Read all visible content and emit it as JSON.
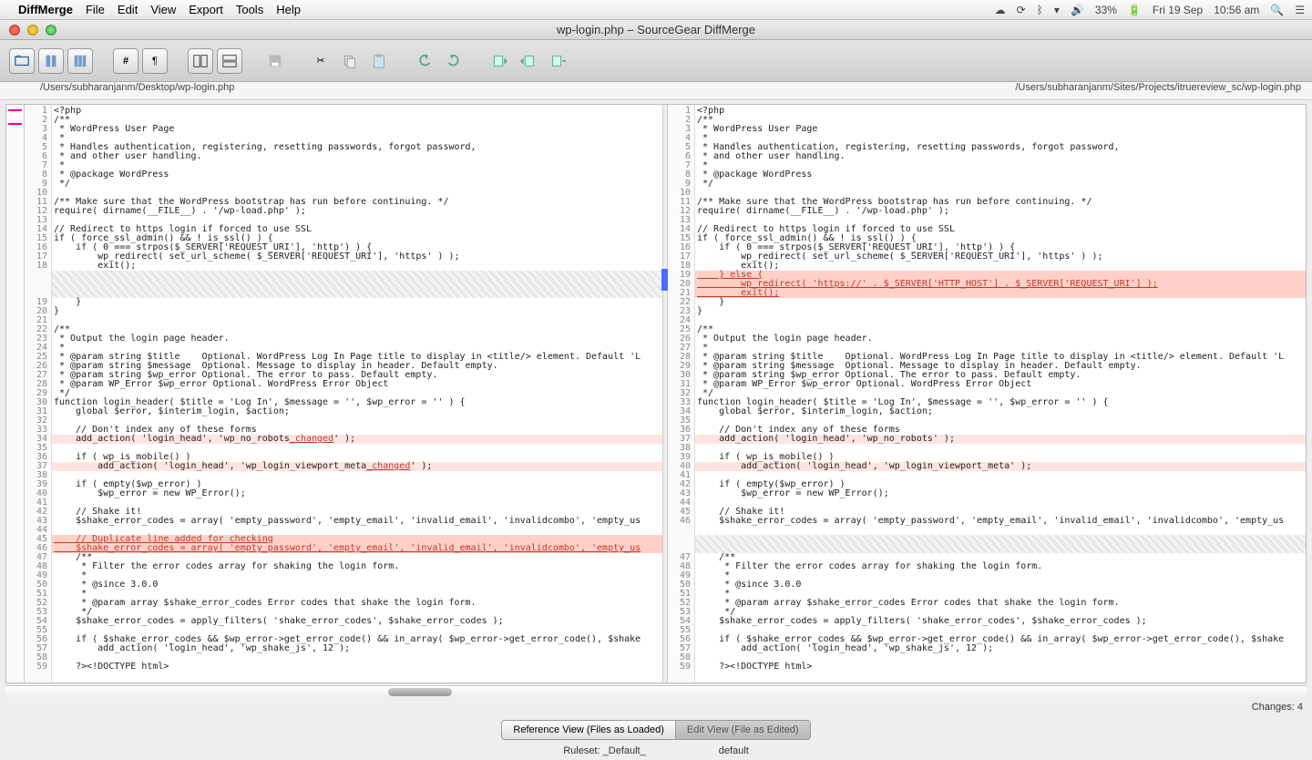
{
  "menubar": {
    "app": "DiffMerge",
    "items": [
      "File",
      "Edit",
      "View",
      "Export",
      "Tools",
      "Help"
    ],
    "right": {
      "battery": "33%",
      "date": "Fri 19 Sep",
      "time": "10:56 am"
    }
  },
  "window": {
    "title": "wp-login.php – SourceGear DiffMerge"
  },
  "paths": {
    "left": "/Users/subharanjanm/Desktop/wp-login.php",
    "right": "/Users/subharanjanm/Sites/Projects/itruereview_sc/wp-login.php"
  },
  "left_code": [
    {
      "n": "1",
      "t": "<?php"
    },
    {
      "n": "2",
      "t": "/**"
    },
    {
      "n": "3",
      "t": " * WordPress User Page"
    },
    {
      "n": "4",
      "t": " *"
    },
    {
      "n": "5",
      "t": " * Handles authentication, registering, resetting passwords, forgot password,"
    },
    {
      "n": "6",
      "t": " * and other user handling."
    },
    {
      "n": "7",
      "t": " *"
    },
    {
      "n": "8",
      "t": " * @package WordPress"
    },
    {
      "n": "9",
      "t": " */"
    },
    {
      "n": "10",
      "t": ""
    },
    {
      "n": "11",
      "t": "/** Make sure that the WordPress bootstrap has run before continuing. */"
    },
    {
      "n": "12",
      "t": "require( dirname(__FILE__) . '/wp-load.php' );"
    },
    {
      "n": "13",
      "t": ""
    },
    {
      "n": "14",
      "t": "// Redirect to https login if forced to use SSL"
    },
    {
      "n": "15",
      "t": "if ( force_ssl_admin() && ! is_ssl() ) {"
    },
    {
      "n": "16",
      "t": "    if ( 0 === strpos($_SERVER['REQUEST_URI'], 'http') ) {"
    },
    {
      "n": "17",
      "t": "        wp_redirect( set_url_scheme( $_SERVER['REQUEST_URI'], 'https' ) );"
    },
    {
      "n": "18",
      "t": "        exit();"
    },
    {
      "n": "",
      "t": "",
      "cls": "hatched"
    },
    {
      "n": "",
      "t": "",
      "cls": "hatched"
    },
    {
      "n": "",
      "t": "",
      "cls": "hatched"
    },
    {
      "n": "19",
      "t": "    }"
    },
    {
      "n": "20",
      "t": "}"
    },
    {
      "n": "21",
      "t": ""
    },
    {
      "n": "22",
      "t": "/**"
    },
    {
      "n": "23",
      "t": " * Output the login page header."
    },
    {
      "n": "24",
      "t": " *"
    },
    {
      "n": "25",
      "t": " * @param string $title    Optional. WordPress Log In Page title to display in <title/> element. Default 'L"
    },
    {
      "n": "26",
      "t": " * @param string $message  Optional. Message to display in header. Default empty."
    },
    {
      "n": "27",
      "t": " * @param string $wp_error Optional. The error to pass. Default empty."
    },
    {
      "n": "28",
      "t": " * @param WP_Error $wp_error Optional. WordPress Error Object"
    },
    {
      "n": "29",
      "t": " */"
    },
    {
      "n": "30",
      "t": "function login_header( $title = 'Log In', $message = '', $wp_error = '' ) {"
    },
    {
      "n": "31",
      "t": "    global $error, $interim_login, $action;"
    },
    {
      "n": "32",
      "t": ""
    },
    {
      "n": "33",
      "t": "    // Don't index any of these forms"
    },
    {
      "n": "34",
      "t": "    add_action( 'login_head', 'wp_no_robots",
      "tail": "_changed",
      "post": "' );",
      "cls": "changed"
    },
    {
      "n": "35",
      "t": ""
    },
    {
      "n": "36",
      "t": "    if ( wp_is_mobile() )"
    },
    {
      "n": "37",
      "t": "        add_action( 'login_head', 'wp_login_viewport_meta",
      "tail": "_changed",
      "post": "' );",
      "cls": "changed"
    },
    {
      "n": "38",
      "t": ""
    },
    {
      "n": "39",
      "t": "    if ( empty($wp_error) )"
    },
    {
      "n": "40",
      "t": "        $wp_error = new WP_Error();"
    },
    {
      "n": "41",
      "t": ""
    },
    {
      "n": "42",
      "t": "    // Shake it!"
    },
    {
      "n": "43",
      "t": "    $shake_error_codes = array( 'empty_password', 'empty_email', 'invalid_email', 'invalidcombo', 'empty_us"
    },
    {
      "n": "44",
      "t": ""
    },
    {
      "n": "45",
      "t": "    // Duplicate line added for checking",
      "cls": "changed-strong",
      "red": true
    },
    {
      "n": "46",
      "t": "    $shake_error_codes = array( 'empty_password', 'empty_email', 'invalid_email', 'invalidcombo', 'empty_us",
      "cls": "changed-strong",
      "red": true
    },
    {
      "n": "47",
      "t": "    /**"
    },
    {
      "n": "48",
      "t": "     * Filter the error codes array for shaking the login form."
    },
    {
      "n": "49",
      "t": "     *"
    },
    {
      "n": "50",
      "t": "     * @since 3.0.0"
    },
    {
      "n": "51",
      "t": "     *"
    },
    {
      "n": "52",
      "t": "     * @param array $shake_error_codes Error codes that shake the login form."
    },
    {
      "n": "53",
      "t": "     */"
    },
    {
      "n": "54",
      "t": "    $shake_error_codes = apply_filters( 'shake_error_codes', $shake_error_codes );"
    },
    {
      "n": "55",
      "t": ""
    },
    {
      "n": "56",
      "t": "    if ( $shake_error_codes && $wp_error->get_error_code() && in_array( $wp_error->get_error_code(), $shake"
    },
    {
      "n": "57",
      "t": "        add_action( 'login_head', 'wp_shake_js', 12 );"
    },
    {
      "n": "58",
      "t": ""
    },
    {
      "n": "59",
      "t": "    ?><!DOCTYPE html>"
    }
  ],
  "right_code": [
    {
      "n": "1",
      "t": "<?php"
    },
    {
      "n": "2",
      "t": "/**"
    },
    {
      "n": "3",
      "t": " * WordPress User Page"
    },
    {
      "n": "4",
      "t": " *"
    },
    {
      "n": "5",
      "t": " * Handles authentication, registering, resetting passwords, forgot password,"
    },
    {
      "n": "6",
      "t": " * and other user handling."
    },
    {
      "n": "7",
      "t": " *"
    },
    {
      "n": "8",
      "t": " * @package WordPress"
    },
    {
      "n": "9",
      "t": " */"
    },
    {
      "n": "10",
      "t": ""
    },
    {
      "n": "11",
      "t": "/** Make sure that the WordPress bootstrap has run before continuing. */"
    },
    {
      "n": "12",
      "t": "require( dirname(__FILE__) . '/wp-load.php' );"
    },
    {
      "n": "13",
      "t": ""
    },
    {
      "n": "14",
      "t": "// Redirect to https login if forced to use SSL"
    },
    {
      "n": "15",
      "t": "if ( force_ssl_admin() && ! is_ssl() ) {"
    },
    {
      "n": "16",
      "t": "    if ( 0 === strpos($_SERVER['REQUEST_URI'], 'http') ) {"
    },
    {
      "n": "17",
      "t": "        wp_redirect( set_url_scheme( $_SERVER['REQUEST_URI'], 'https' ) );"
    },
    {
      "n": "18",
      "t": "        exit();"
    },
    {
      "n": "19",
      "t": "    } else {",
      "cls": "changed-strong",
      "red": true
    },
    {
      "n": "20",
      "t": "        wp_redirect( 'https://' . $_SERVER['HTTP_HOST'] . $_SERVER['REQUEST_URI'] );",
      "cls": "changed-strong",
      "red": true
    },
    {
      "n": "21",
      "t": "        exit();",
      "cls": "changed-strong",
      "red": true
    },
    {
      "n": "22",
      "t": "    }"
    },
    {
      "n": "23",
      "t": "}"
    },
    {
      "n": "24",
      "t": ""
    },
    {
      "n": "25",
      "t": "/**"
    },
    {
      "n": "26",
      "t": " * Output the login page header."
    },
    {
      "n": "27",
      "t": " *"
    },
    {
      "n": "28",
      "t": " * @param string $title    Optional. WordPress Log In Page title to display in <title/> element. Default 'L"
    },
    {
      "n": "29",
      "t": " * @param string $message  Optional. Message to display in header. Default empty."
    },
    {
      "n": "30",
      "t": " * @param string $wp_error Optional. The error to pass. Default empty."
    },
    {
      "n": "31",
      "t": " * @param WP_Error $wp_error Optional. WordPress Error Object"
    },
    {
      "n": "32",
      "t": " */"
    },
    {
      "n": "33",
      "t": "function login_header( $title = 'Log In', $message = '', $wp_error = '' ) {"
    },
    {
      "n": "34",
      "t": "    global $error, $interim_login, $action;"
    },
    {
      "n": "35",
      "t": ""
    },
    {
      "n": "36",
      "t": "    // Don't index any of these forms"
    },
    {
      "n": "37",
      "t": "    add_action( 'login_head', 'wp_no_robots' );",
      "cls": "changed"
    },
    {
      "n": "38",
      "t": ""
    },
    {
      "n": "39",
      "t": "    if ( wp_is_mobile() )"
    },
    {
      "n": "40",
      "t": "        add_action( 'login_head', 'wp_login_viewport_meta' );",
      "cls": "changed"
    },
    {
      "n": "41",
      "t": ""
    },
    {
      "n": "42",
      "t": "    if ( empty($wp_error) )"
    },
    {
      "n": "43",
      "t": "        $wp_error = new WP_Error();"
    },
    {
      "n": "44",
      "t": ""
    },
    {
      "n": "45",
      "t": "    // Shake it!"
    },
    {
      "n": "46",
      "t": "    $shake_error_codes = array( 'empty_password', 'empty_email', 'invalid_email', 'invalidcombo', 'empty_us"
    },
    {
      "n": "",
      "t": ""
    },
    {
      "n": "",
      "t": "",
      "cls": "hatched"
    },
    {
      "n": "",
      "t": "",
      "cls": "hatched"
    },
    {
      "n": "47",
      "t": "    /**"
    },
    {
      "n": "48",
      "t": "     * Filter the error codes array for shaking the login form."
    },
    {
      "n": "49",
      "t": "     *"
    },
    {
      "n": "50",
      "t": "     * @since 3.0.0"
    },
    {
      "n": "51",
      "t": "     *"
    },
    {
      "n": "52",
      "t": "     * @param array $shake_error_codes Error codes that shake the login form."
    },
    {
      "n": "53",
      "t": "     */"
    },
    {
      "n": "54",
      "t": "    $shake_error_codes = apply_filters( 'shake_error_codes', $shake_error_codes );"
    },
    {
      "n": "55",
      "t": ""
    },
    {
      "n": "56",
      "t": "    if ( $shake_error_codes && $wp_error->get_error_code() && in_array( $wp_error->get_error_code(), $shake"
    },
    {
      "n": "57",
      "t": "        add_action( 'login_head', 'wp_shake_js', 12 );"
    },
    {
      "n": "58",
      "t": ""
    },
    {
      "n": "59",
      "t": "    ?><!DOCTYPE html>"
    }
  ],
  "status": {
    "changes": "Changes: 4"
  },
  "toggle": {
    "left": "Reference View (Files as Loaded)",
    "right": "Edit View (File as Edited)"
  },
  "footer": {
    "ruleset": "Ruleset: _Default_",
    "enc": "default"
  }
}
